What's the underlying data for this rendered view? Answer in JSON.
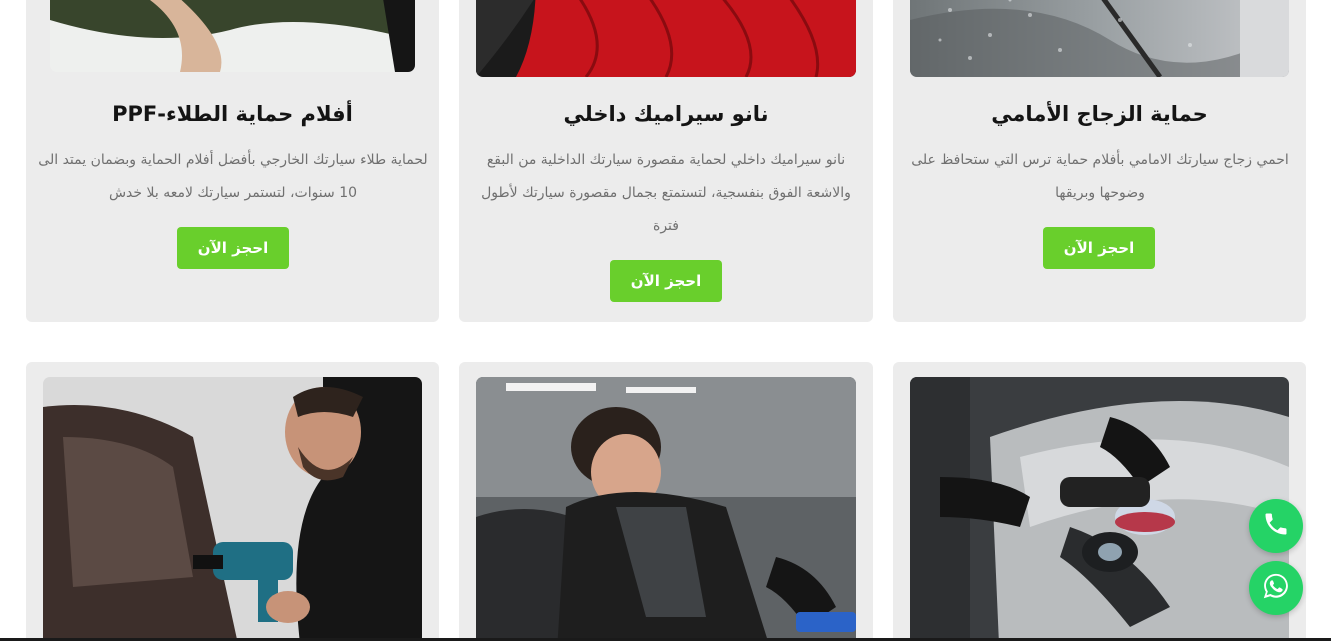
{
  "services_row1": [
    {
      "title": "حماية الزجاج الأمامي",
      "description": "احمي زجاج سيارتك الامامي بأفلام حماية ترس التي ستحافظ على وضوحها وبريقها",
      "button": "احجز الآن"
    },
    {
      "title": "نانو سيراميك داخلي",
      "description": "نانو سيراميك داخلي لحماية مقصورة سيارتك الداخلية من البقع والاشعة الفوق بنفسجية، لتستمتع بجمال مقصورة سيارتك لأطول فترة",
      "button": "احجز الآن"
    },
    {
      "title": "أفلام حماية الطلاء-PPF",
      "description": "لحماية طلاء سيارتك الخارجي بأفضل أفلام الحماية وبضمان يمتد الى 10 سنوات، لتستمر سيارتك لامعه بلا خدش",
      "button": "احجز الآن"
    }
  ],
  "images": {
    "windshield": "windshield-photo",
    "interior": "red-leather-seat-photo",
    "ppf": "ppf-film-application-photo",
    "polishing": "car-polishing-photo",
    "detailing": "interior-detailing-photo",
    "heat_gun": "heat-gun-tint-photo"
  },
  "floating": {
    "phone_icon": "phone-icon",
    "whatsapp_icon": "whatsapp-icon",
    "color": "#25d366"
  },
  "colors": {
    "card_bg": "#ececec",
    "button_bg": "#69cf2c",
    "title": "#141414",
    "text": "#707070"
  }
}
